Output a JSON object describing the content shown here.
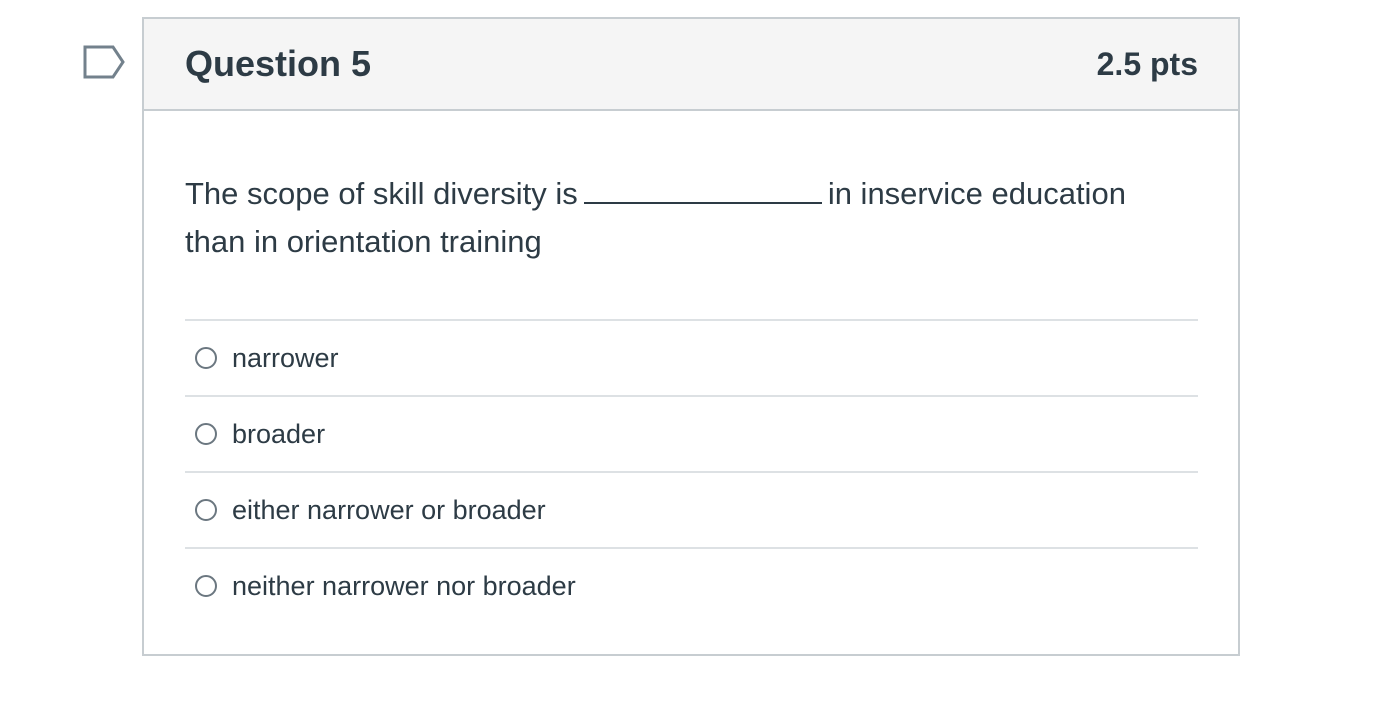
{
  "question": {
    "title": "Question 5",
    "points": "2.5 pts",
    "text_before": "The scope of skill diversity is",
    "text_after": "in inservice education than in orientation training",
    "flag_icon": "bookmark-flag-icon",
    "answers": [
      {
        "label": "narrower"
      },
      {
        "label": "broader"
      },
      {
        "label": "either narrower or broader"
      },
      {
        "label": "neither narrower nor broader"
      }
    ]
  },
  "colors": {
    "text": "#2d3b45",
    "border": "#c7cdd1",
    "header_bg": "#f5f5f5",
    "flag": "#73818c"
  }
}
